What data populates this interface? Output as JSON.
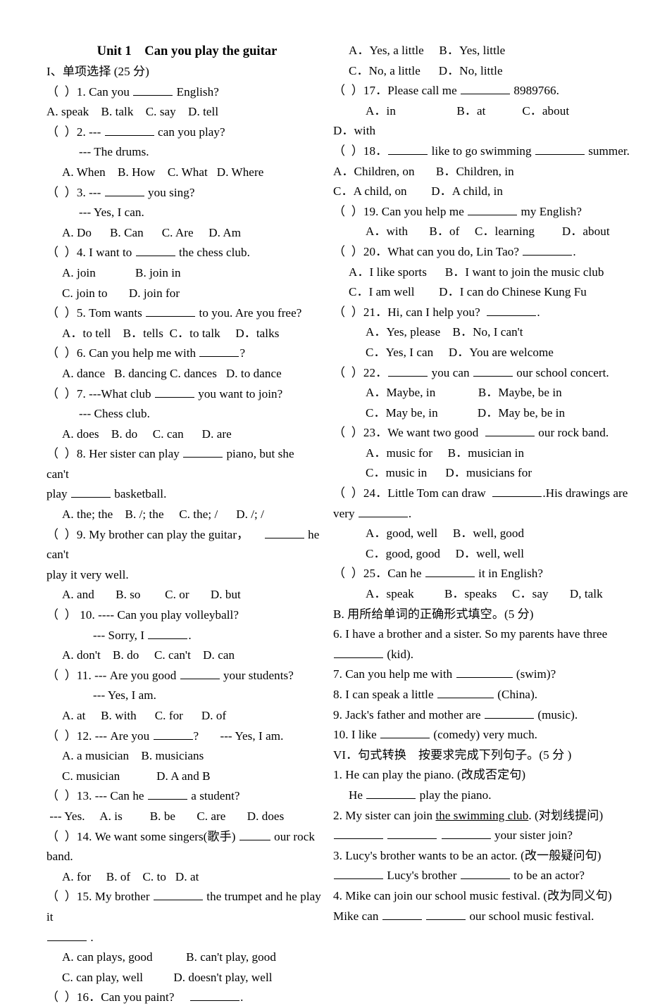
{
  "document": {
    "title": "Unit 1    Can you play the guitar",
    "section_1_heading": "I、单项选择 (25 分)",
    "section_b_heading": "B. 用所给单词的正确形式填空。(5 分)",
    "section_vi_heading": "VI．句式转换　按要求完成下列句子。(5 分 )"
  },
  "left_column": {
    "lines": [
      {
        "id": "q1-stem",
        "text": "（  ）1. Can you ______ English?",
        "indent": 0
      },
      {
        "id": "q1-options",
        "text": "A. speak    B. talk    C. say    D. tell",
        "indent": 0
      },
      {
        "id": "q2-stem",
        "text": "（  ）2. --- ________ can you play?",
        "indent": 0
      },
      {
        "id": "q2-reply",
        "text": "--- The drums.",
        "indent": 2
      },
      {
        "id": "q2-options",
        "text": "A. When    B. How    C. What   D. Where",
        "indent": 1
      },
      {
        "id": "q3-stem",
        "text": "（  ）3. --- ______ you sing?",
        "indent": 0
      },
      {
        "id": "q3-reply",
        "text": "--- Yes, I can.",
        "indent": 2
      },
      {
        "id": "q3-options",
        "text": "A. Do      B. Can      C. Are     D. Am",
        "indent": 1
      },
      {
        "id": "q4-stem",
        "text": "（  ）4. I want to ______ the chess club.",
        "indent": 0
      },
      {
        "id": "q4-options-ab",
        "text": "A. join             B. join in",
        "indent": 1
      },
      {
        "id": "q4-options-cd",
        "text": "C. join to       D. join for",
        "indent": 1
      },
      {
        "id": "q5-stem",
        "text": "（  ）5. Tom wants ________ to you. Are you free?",
        "indent": 0
      },
      {
        "id": "q5-options",
        "text": "A．to tell    B．tells  C．to talk     D．talks",
        "indent": 1
      },
      {
        "id": "q6-stem",
        "text": "（  ）6. Can you help me with ______?",
        "indent": 0
      },
      {
        "id": "q6-options",
        "text": "A. dance   B. dancing C. dances   D. to dance",
        "indent": 1
      },
      {
        "id": "q7-stem",
        "text": "（  ）7. ---What club ______ you want to join?",
        "indent": 0
      },
      {
        "id": "q7-reply",
        "text": "--- Chess club.",
        "indent": 2
      },
      {
        "id": "q7-options",
        "text": "A. does    B. do     C. can      D. are",
        "indent": 1
      },
      {
        "id": "q8-stem",
        "text": "（  ）8. Her sister can play ______ piano, but she      can't",
        "indent": 0
      },
      {
        "id": "q8-stem-cont",
        "text": "play _____ basketball.",
        "indent": 0
      },
      {
        "id": "q8-options",
        "text": "A. the; the    B. /; the     C. the; /      D. /; /",
        "indent": 1
      },
      {
        "id": "q9-stem",
        "text": "（  ）9. My brother can play the guitar，     ______ he can't",
        "indent": 0
      },
      {
        "id": "q9-stem-cont",
        "text": "play it very well.",
        "indent": 0
      },
      {
        "id": "q9-options",
        "text": "A. and       B. so        C. or       D. but",
        "indent": 1
      },
      {
        "id": "q10-stem",
        "text": "（  ） 10. ---- Can you play volleyball?",
        "indent": 0
      },
      {
        "id": "q10-reply",
        "text": "--- Sorry, I ______.",
        "indent": 3
      },
      {
        "id": "q10-options",
        "text": "A. don't    B. do     C. can't    D. can",
        "indent": 1
      },
      {
        "id": "q11-stem",
        "text": "（  ）11. --- Are you good ______ your students?",
        "indent": 0
      },
      {
        "id": "q11-reply",
        "text": "--- Yes, I am.",
        "indent": 3
      },
      {
        "id": "q11-options",
        "text": "A. at     B. with      C. for      D. of",
        "indent": 1
      },
      {
        "id": "q12-stem",
        "text": "（  ）12. --- Are you ______?       --- Yes, I am.",
        "indent": 0
      },
      {
        "id": "q12-options-ab",
        "text": "A. a musician    B. musicians",
        "indent": 1
      },
      {
        "id": "q12-options-cd",
        "text": "C. musician            D. A and B",
        "indent": 1
      },
      {
        "id": "q13-stem",
        "text": "（  ）13. --- Can he ______ a student?",
        "indent": 0
      },
      {
        "id": "q13-reply-options",
        "text": " --- Yes.     A. is         B. be       C. are       D. does",
        "indent": 0
      },
      {
        "id": "q14-stem",
        "text": "（  ）14. We want some singers(歌手) ____ our rock band.",
        "indent": 0
      },
      {
        "id": "q14-options",
        "text": "A. for     B. of    C. to   D. at",
        "indent": 1
      },
      {
        "id": "q15-stem",
        "text": "（  ）15. My brother ________ the trumpet and he play it",
        "indent": 0
      },
      {
        "id": "q15-stem-cont",
        "text": "_____ .",
        "indent": 0
      },
      {
        "id": "q15-options-ab",
        "text": "A. can plays, good           B. can't play, good",
        "indent": 1
      },
      {
        "id": "q15-options-cd",
        "text": "C. can play, well          D. doesn't play, well",
        "indent": 1
      },
      {
        "id": "q16-stem",
        "text": "（  ）16．Can you paint?     ________.",
        "indent": 0
      }
    ]
  },
  "right_column": {
    "lines": [
      {
        "id": "q16-options-ab",
        "text": "A．Yes, a little     B．Yes, little",
        "indent": 1
      },
      {
        "id": "q16-options-cd",
        "text": "C．No, a little      D．No, little",
        "indent": 1
      },
      {
        "id": "q17-stem",
        "text": "（  ）17．Please call me ________ 8989766.",
        "indent": 0
      },
      {
        "id": "q17-options-abc",
        "text": "A．in                    B．at            C．about",
        "indent": 2
      },
      {
        "id": "q17-options-d",
        "text": "D．with",
        "indent": 0
      },
      {
        "id": "q18-stem",
        "text": "（  ）18．_____ like to go swimming ________ summer.",
        "indent": 0
      },
      {
        "id": "q18-options-ab",
        "text": "A．Children, on       B．Children, in",
        "indent": 0
      },
      {
        "id": "q18-options-cd",
        "text": "C．A child, on        D．A child, in",
        "indent": 0
      },
      {
        "id": "q19-stem",
        "text": "（  ）19. Can you help me ________ my English?",
        "indent": 0
      },
      {
        "id": "q19-options",
        "text": "A．with       B．of     C．learning         D．about",
        "indent": 2
      },
      {
        "id": "q20-stem",
        "text": "（  ）20．What can you do, Lin Tao? ________.",
        "indent": 0
      },
      {
        "id": "q20-options-ab",
        "text": "A．I like sports      B．I want to join the music club",
        "indent": 1
      },
      {
        "id": "q20-options-cd",
        "text": "C．I am well        D．I can do Chinese Kung Fu",
        "indent": 1
      },
      {
        "id": "q21-stem",
        "text": "（  ）21．Hi, can I help you?  ________.",
        "indent": 0
      },
      {
        "id": "q21-options-ab",
        "text": "A．Yes, please    B．No, I can't",
        "indent": 2
      },
      {
        "id": "q21-options-cd",
        "text": "C．Yes, I can     D．You are welcome",
        "indent": 2
      },
      {
        "id": "q22-stem",
        "text": "（  ）22．_____ you can _____ our school concert.",
        "indent": 0
      },
      {
        "id": "q22-options-ab",
        "text": "A．Maybe, in              B．Maybe, be in",
        "indent": 2
      },
      {
        "id": "q22-options-cd",
        "text": "C．May be, in             D．May be, be in",
        "indent": 2
      },
      {
        "id": "q23-stem",
        "text": "（  ）23．We want two good  ________ our rock band.",
        "indent": 0
      },
      {
        "id": "q23-options-ab",
        "text": "A．music for     B．musician in",
        "indent": 2
      },
      {
        "id": "q23-options-cd",
        "text": "C．music in      D．musicians for",
        "indent": 2
      },
      {
        "id": "q24-stem",
        "text": "（  ）24．Little Tom can draw  ________.His drawings are",
        "indent": 0
      },
      {
        "id": "q24-stem-cont",
        "text": "very ________.",
        "indent": 0
      },
      {
        "id": "q24-options-ab",
        "text": "A．good, well     B．well, good",
        "indent": 2
      },
      {
        "id": "q24-options-cd",
        "text": "C．good, good     D．well, well",
        "indent": 2
      },
      {
        "id": "q25-stem",
        "text": "（  ）25．Can he ________ it in English?",
        "indent": 0
      },
      {
        "id": "q25-options",
        "text": "A．speak          B．speaks     C．say       D, talk",
        "indent": 2
      },
      {
        "id": "section-b",
        "text": "B. 用所给单词的正确形式填空。(5 分)",
        "indent": 0
      },
      {
        "id": "fill-6",
        "text": "6. I have a brother and a sister. So my parents have three",
        "indent": 0
      },
      {
        "id": "fill-6-cont",
        "text": "________ (kid).",
        "indent": 0
      },
      {
        "id": "fill-7",
        "text": "7. Can you help me with _________ (swim)?",
        "indent": 0
      },
      {
        "id": "fill-8",
        "text": "8. I can speak a little _________ (China).",
        "indent": 0
      },
      {
        "id": "fill-9",
        "text": "9. Jack's father and mother are _______ (music).",
        "indent": 0
      },
      {
        "id": "fill-10",
        "text": "10. I like ________ (comedy) very much.",
        "indent": 0
      },
      {
        "id": "section-vi",
        "text": "VI．句式转换　按要求完成下列句子。(5 分 )",
        "indent": 0
      },
      {
        "id": "trans-1",
        "text": "1. He can play the piano. (改成否定句)",
        "indent": 0
      },
      {
        "id": "trans-1-answer",
        "text": "He ________ play the piano.",
        "indent": 1
      },
      {
        "id": "trans-2",
        "text": "2. My sister can join the swimming club. (对划线提问)",
        "indent": 0,
        "underline_part": "the swimming club"
      },
      {
        "id": "trans-2-answer",
        "text": "_______ ________ ________ your sister join?",
        "indent": 0
      },
      {
        "id": "trans-3",
        "text": "3. Lucy's brother wants to be an actor. (改一般疑问句)",
        "indent": 0
      },
      {
        "id": "trans-3-answer",
        "text": "_______ Lucy's brother _______ to be an actor?",
        "indent": 0
      },
      {
        "id": "trans-4",
        "text": "4. Mike can join our school music festival. (改为同义句)",
        "indent": 0
      },
      {
        "id": "trans-4-answer",
        "text": "Mike can ______ ______ our school music festival.",
        "indent": 0
      }
    ]
  }
}
